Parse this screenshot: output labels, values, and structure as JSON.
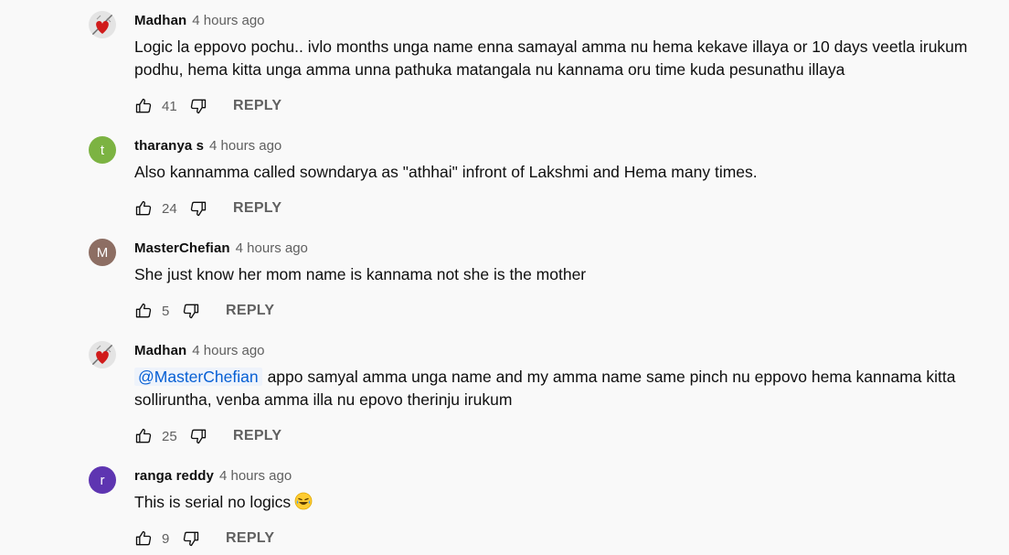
{
  "comments": [
    {
      "author": "Madhan",
      "time": "4 hours ago",
      "avatar_type": "heart-rose-image",
      "mention": "",
      "text": "Logic la eppovo pochu.. ivlo months unga name enna samayal amma nu hema kekave illaya or 10 days veetla irukum podhu, hema kitta unga amma unna pathuka matangala nu kannama oru time kuda pesunathu illaya",
      "likes": "41",
      "reply_label": "REPLY"
    },
    {
      "author": "tharanya s",
      "time": "4 hours ago",
      "avatar_type": "letter",
      "avatar_letter": "t",
      "avatar_color": "#7cb342",
      "mention": "",
      "text": "Also kannamma called sowndarya as \"athhai\" infront of Lakshmi and Hema many times.",
      "likes": "24",
      "reply_label": "REPLY"
    },
    {
      "author": "MasterChefian",
      "time": "4 hours ago",
      "avatar_type": "letter",
      "avatar_letter": "M",
      "avatar_color": "#8d6e63",
      "mention": "",
      "text": "She just know her mom name is kannama not she is the mother",
      "likes": "5",
      "reply_label": "REPLY"
    },
    {
      "author": "Madhan",
      "time": "4 hours ago",
      "avatar_type": "heart-rose-image",
      "mention": "@MasterChefian",
      "text": "appo samyal amma unga name and my amma name same pinch nu eppovo hema kannama kitta solliruntha, venba amma illa nu epovo therinju irukum",
      "likes": "25",
      "reply_label": "REPLY"
    },
    {
      "author": "ranga reddy",
      "time": "4 hours ago",
      "avatar_type": "letter",
      "avatar_letter": "r",
      "avatar_color": "#5e35b1",
      "mention": "",
      "text": "This is serial no logics",
      "emoji": "laughing-tears-emoji",
      "likes": "9",
      "reply_label": "REPLY"
    }
  ],
  "icons": {
    "like": "thumbs-up-icon",
    "dislike": "thumbs-down-icon"
  },
  "colors": {
    "background": "#f9f9f9",
    "secondary_text": "#606060",
    "mention": "#065fd4"
  }
}
